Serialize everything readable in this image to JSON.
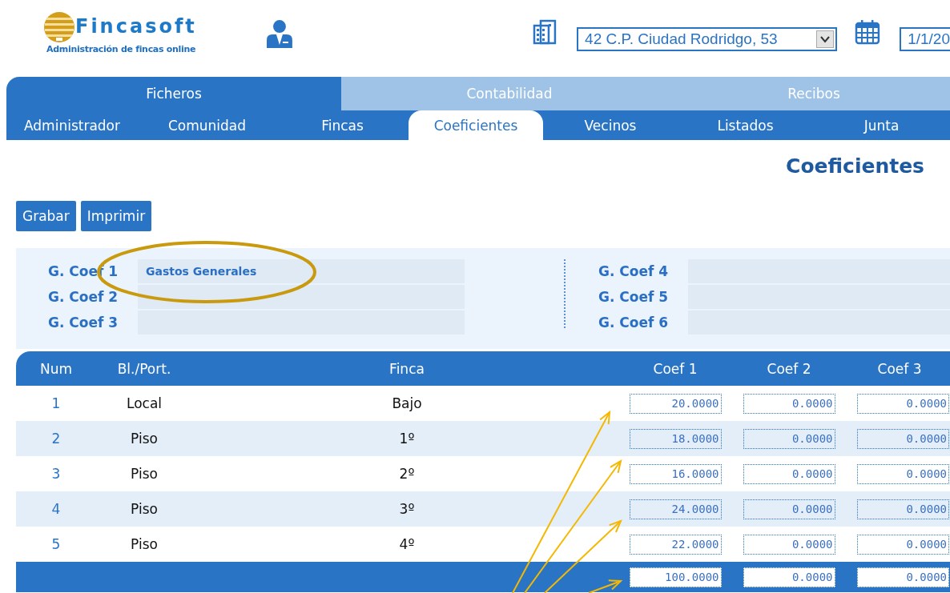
{
  "header": {
    "brand": "Fincasoft",
    "tagline": "Administración de fincas online",
    "community_select": {
      "value": "42 C.P. Ciudad Rodridgo, 53"
    },
    "date_field": {
      "value": "1/1/20"
    }
  },
  "main_tabs": [
    {
      "label": "Ficheros",
      "selected": true
    },
    {
      "label": "Contabilidad",
      "selected": false
    },
    {
      "label": "Recibos",
      "selected": false
    }
  ],
  "sub_tabs": [
    {
      "label": "Administrador",
      "selected": false
    },
    {
      "label": "Comunidad",
      "selected": false
    },
    {
      "label": "Fincas",
      "selected": false
    },
    {
      "label": "Coeficientes",
      "selected": true
    },
    {
      "label": "Vecinos",
      "selected": false
    },
    {
      "label": "Listados",
      "selected": false
    },
    {
      "label": "Junta",
      "selected": false
    }
  ],
  "page_title": "Coeficientes",
  "buttons": [
    "Grabar",
    "Imprimir"
  ],
  "coef_groups": [
    {
      "label": "G. Coef 1",
      "value": "Gastos Generales"
    },
    {
      "label": "G. Coef 2"
    },
    {
      "label": "G. Coef 3"
    },
    {
      "label": "G. Coef 4"
    },
    {
      "label": "G. Coef 5"
    },
    {
      "label": "G. Coef 6"
    }
  ],
  "table": {
    "columns": [
      "Num",
      "Bl./Port.",
      "Finca",
      "Coef 1",
      "Coef 2",
      "Coef 3"
    ],
    "rows": [
      {
        "num": "1",
        "block": "Local",
        "finca": "Bajo",
        "coefs": [
          "20.0000",
          "0.0000",
          "0.0000"
        ]
      },
      {
        "num": "2",
        "block": "Piso",
        "finca": "1º",
        "coefs": [
          "18.0000",
          "0.0000",
          "0.0000"
        ]
      },
      {
        "num": "3",
        "block": "Piso",
        "finca": "2º",
        "coefs": [
          "16.0000",
          "0.0000",
          "0.0000"
        ]
      },
      {
        "num": "4",
        "block": "Piso",
        "finca": "3º",
        "coefs": [
          "24.0000",
          "0.0000",
          "0.0000"
        ]
      },
      {
        "num": "5",
        "block": "Piso",
        "finca": "4º",
        "coefs": [
          "22.0000",
          "0.0000",
          "0.0000"
        ]
      }
    ],
    "totals": [
      "100.0000",
      "0.0000",
      "0.0000"
    ]
  }
}
